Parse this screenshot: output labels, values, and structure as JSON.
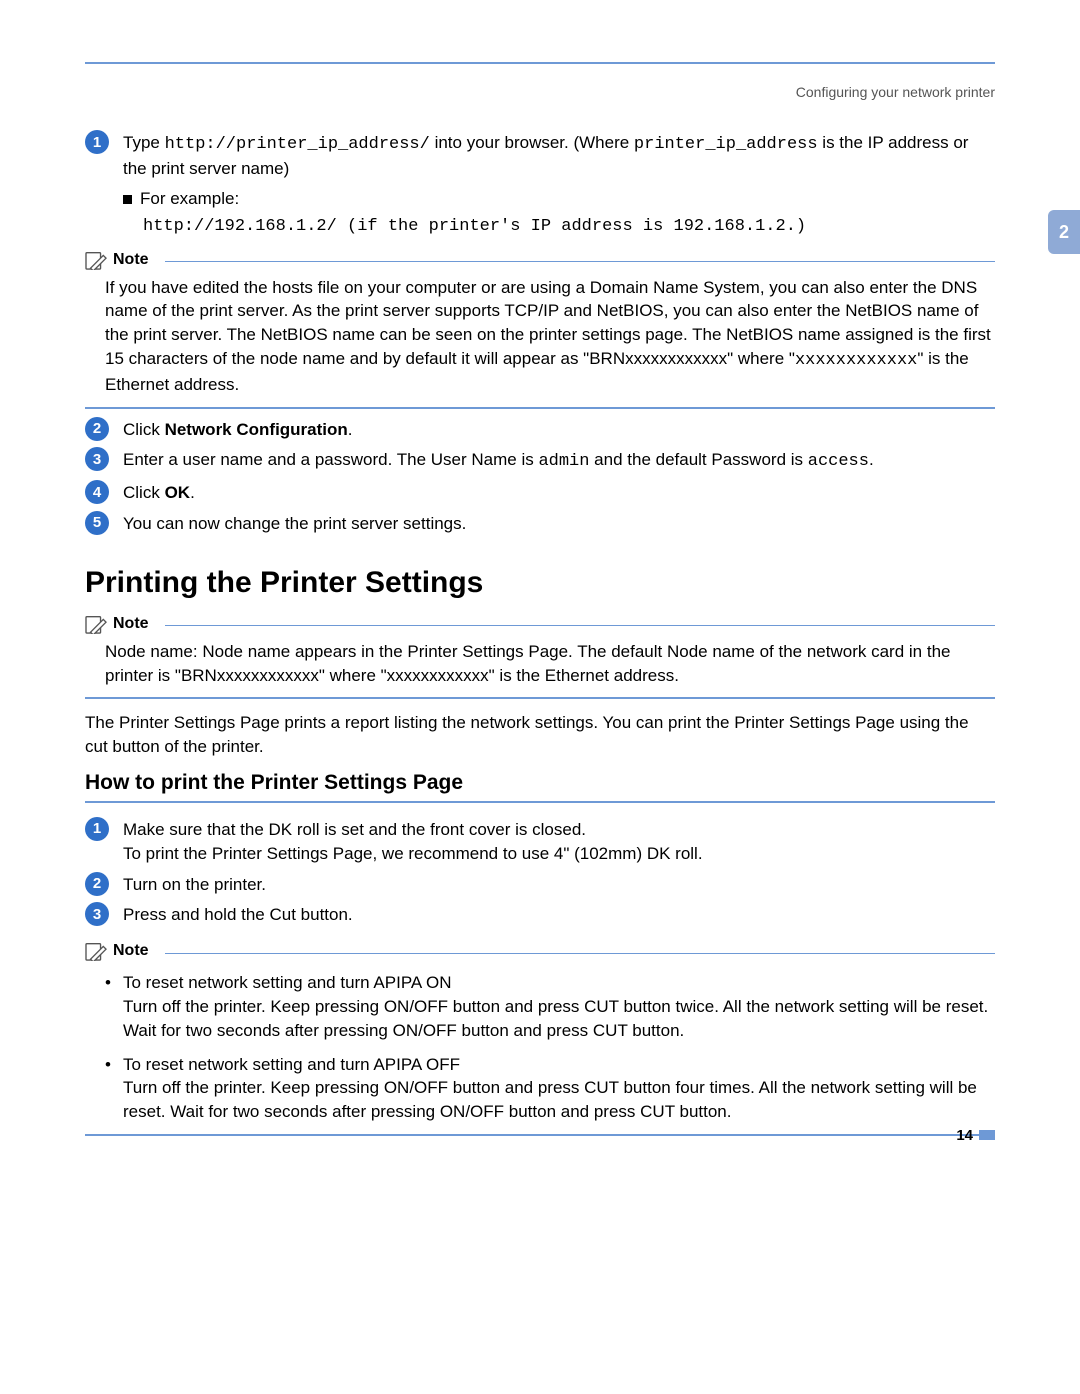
{
  "header": {
    "breadcrumb": "Configuring your network printer",
    "chapter_tab": "2"
  },
  "steps_a": [
    {
      "num": "1",
      "text_pre": "Type ",
      "code1": "http://printer_ip_address/",
      "text_mid": " into your browser. (Where ",
      "code2": "printer_ip_address",
      "text_post": " is the IP address or the print server name)"
    }
  ],
  "example": {
    "label": "For example:",
    "code": "http://192.168.1.2/ (if the printer's IP address is 192.168.1.2.)"
  },
  "note1": {
    "label": "Note",
    "body_pre": "If you have edited the hosts file on your computer or are using a Domain Name System, you can also enter the DNS name of the print server. As the print server supports TCP/IP and NetBIOS, you can also enter the NetBIOS name of the print server. The NetBIOS name can be seen on the printer settings page. The NetBIOS name assigned is the first 15 characters of the node name and by default it will appear as \"BRNxxxxxxxxxxxx\" where \"",
    "body_code": "xxxxxxxxxxxx",
    "body_post": "\" is the Ethernet address."
  },
  "steps_b": [
    {
      "num": "2",
      "pre": "Click ",
      "bold": "Network Configuration",
      "post": "."
    },
    {
      "num": "3",
      "pre": "Enter a user name and a password. The User Name is ",
      "code1": "admin",
      "mid": " and the default Password is ",
      "code2": "access",
      "post": "."
    },
    {
      "num": "4",
      "pre": "Click ",
      "bold": "OK",
      "post": "."
    },
    {
      "num": "5",
      "plain": "You can now change the print server settings."
    }
  ],
  "section": {
    "title": "Printing the Printer Settings"
  },
  "note2": {
    "label": "Note",
    "body": "Node name: Node name appears in the Printer Settings Page. The default Node name of the network card in the printer is \"BRNxxxxxxxxxxxx\" where \"xxxxxxxxxxxx\" is the Ethernet address."
  },
  "section_para": "The Printer Settings Page prints a report listing the network settings. You can print the Printer Settings Page using the cut button of the printer.",
  "subsection": {
    "title": "How to print the Printer Settings Page"
  },
  "steps_c": [
    {
      "num": "1",
      "line1": "Make sure that the DK roll is set and the front cover is closed.",
      "line2": "To print the Printer Settings Page, we recommend to use 4\" (102mm) DK roll."
    },
    {
      "num": "2",
      "plain": "Turn on the printer."
    },
    {
      "num": "3",
      "plain": "Press and hold the Cut button."
    }
  ],
  "note3": {
    "label": "Note",
    "items": [
      {
        "head": "To reset network setting and turn APIPA ON",
        "body": "Turn off the printer. Keep pressing ON/OFF button and press CUT button twice. All the network setting will be reset. Wait for two seconds after pressing ON/OFF button and press CUT button."
      },
      {
        "head": "To reset network setting and turn APIPA OFF",
        "body": "Turn off the printer. Keep pressing ON/OFF button and press CUT button four times. All the network setting will be reset. Wait for two seconds after pressing ON/OFF button and press CUT button."
      }
    ]
  },
  "page_number": "14"
}
